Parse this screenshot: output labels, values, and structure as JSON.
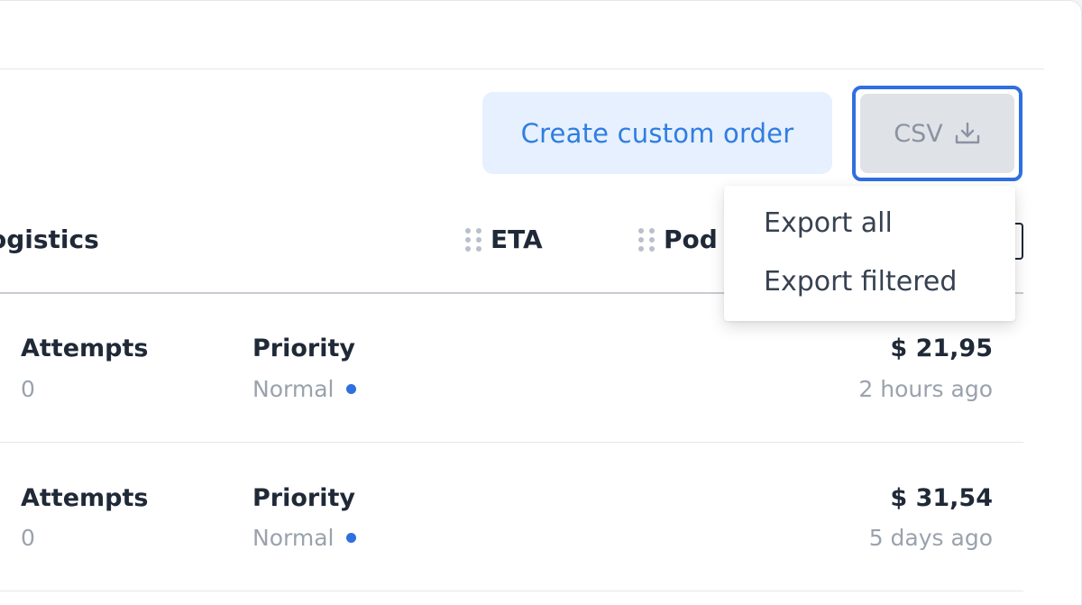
{
  "toolbar": {
    "create_label": "Create custom order",
    "csv_label": "CSV",
    "csv_icon": "download-icon"
  },
  "columns": {
    "logistics": "ogistics",
    "eta": "ETA",
    "pod": "Pod"
  },
  "rows": [
    {
      "attempts_label": "Attempts",
      "attempts_value": "0",
      "priority_label": "Priority",
      "priority_value": "Normal",
      "amount": "$ 21,95",
      "time": "2 hours ago"
    },
    {
      "attempts_label": "Attempts",
      "attempts_value": "0",
      "priority_label": "Priority",
      "priority_value": "Normal",
      "amount": "$ 31,54",
      "time": "5 days ago"
    }
  ],
  "export_menu": {
    "items": [
      "Export all",
      "Export filtered"
    ]
  },
  "colors": {
    "accent": "#2f7de1",
    "focus_ring": "#2f6fe0",
    "priority_dot": "#2f6fe0"
  }
}
